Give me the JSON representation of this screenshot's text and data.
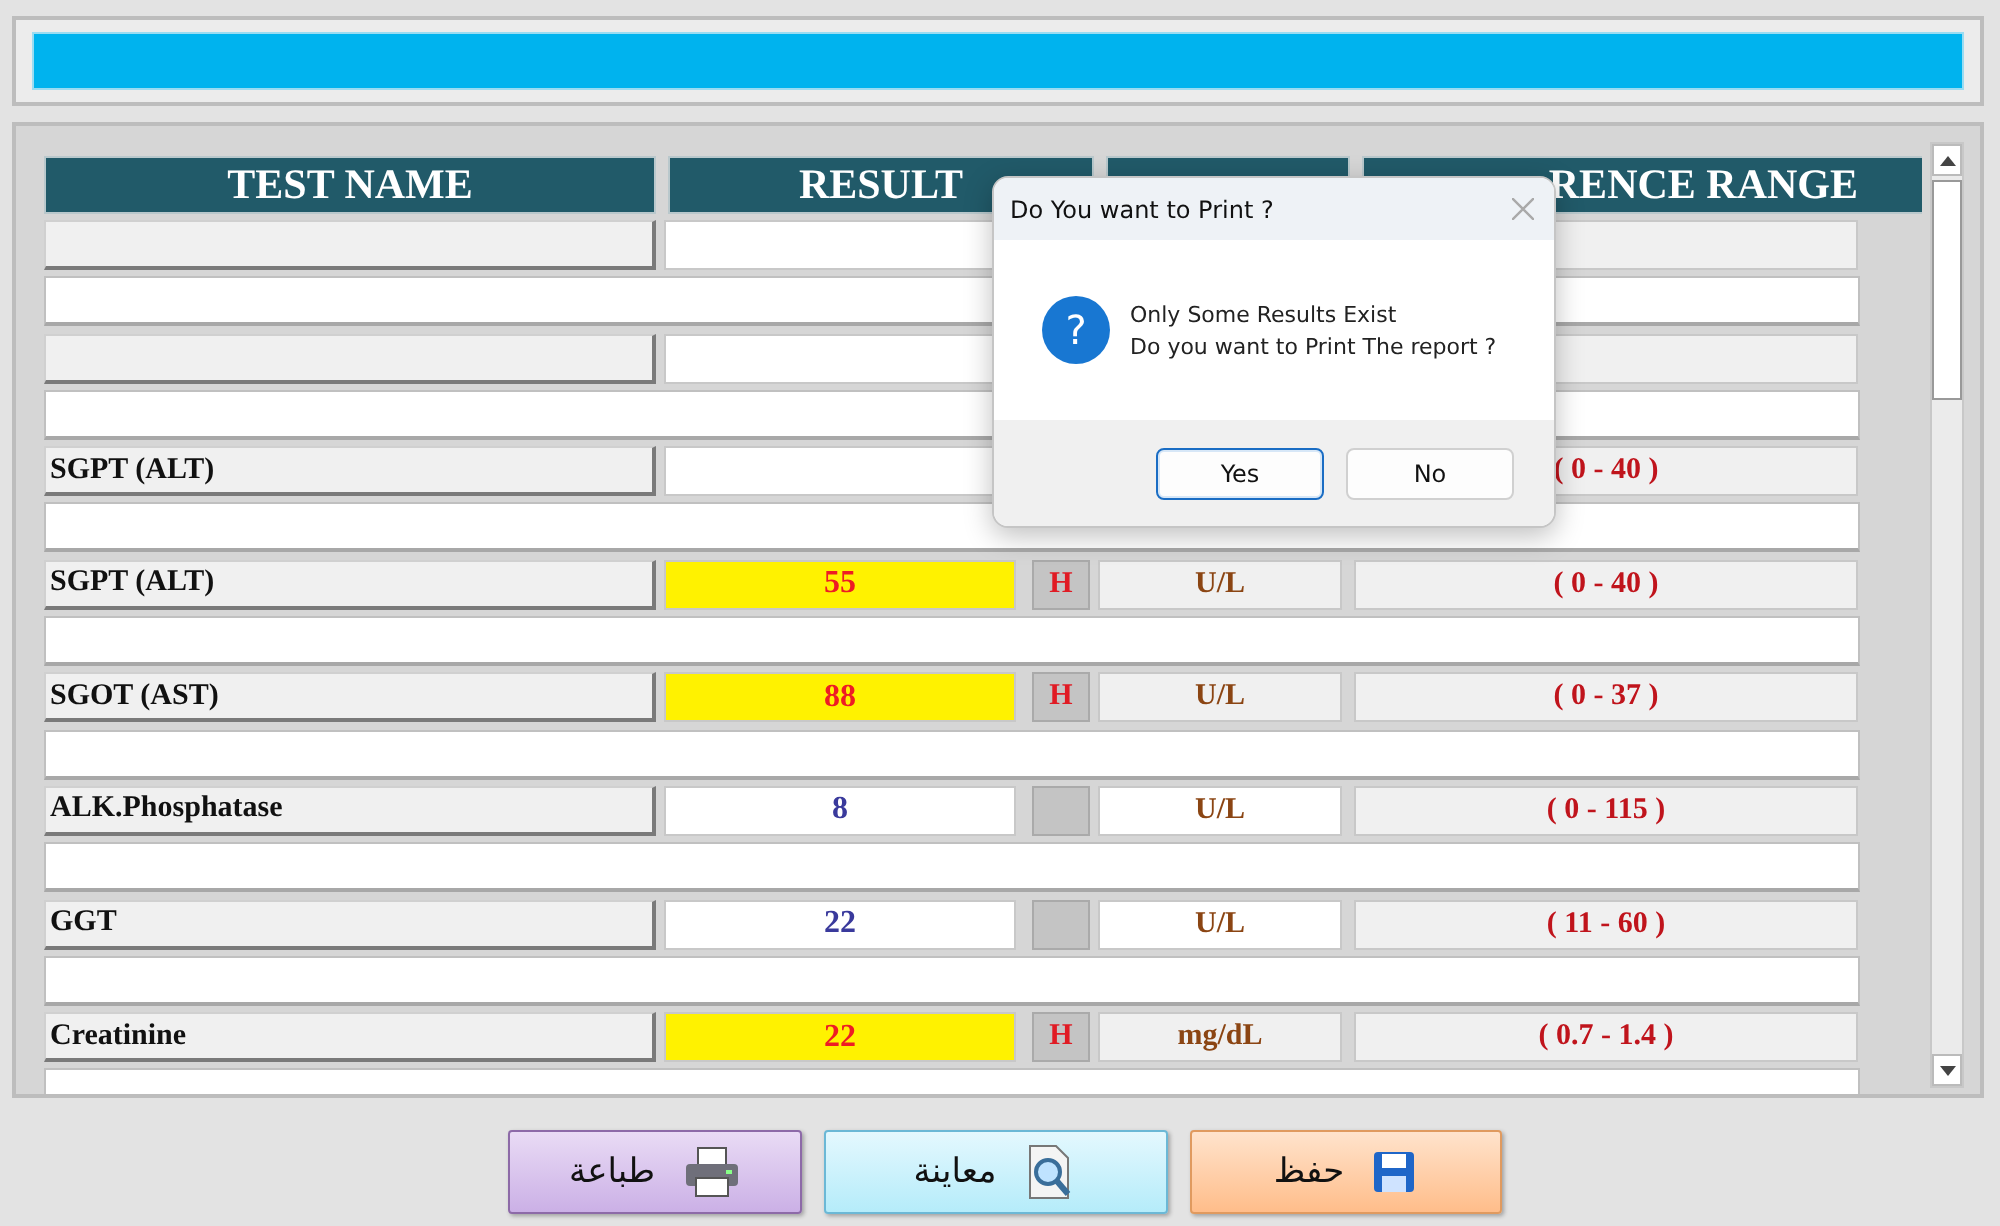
{
  "columns": [
    {
      "label": "TEST NAME"
    },
    {
      "label": "RESULT"
    },
    {},
    {
      "label": "RENCE RANGE"
    }
  ],
  "rows": [
    {
      "kind": "blank",
      "high": false
    },
    {
      "kind": "note"
    },
    {
      "kind": "blank",
      "high": false
    },
    {
      "kind": "note"
    },
    {
      "kind": "test",
      "name": "SGPT (ALT)",
      "high": false,
      "range": "( 0 - 40 )"
    },
    {
      "kind": "note"
    },
    {
      "kind": "test",
      "name": "SGPT (ALT)",
      "result": "55",
      "high": true,
      "flag": "H",
      "unit": "U/L",
      "range": "( 0 - 40 )"
    },
    {
      "kind": "note"
    },
    {
      "kind": "test",
      "name": "SGOT (AST)",
      "result": "88",
      "high": true,
      "flag": "H",
      "unit": "U/L",
      "range": "( 0 - 37 )"
    },
    {
      "kind": "note"
    },
    {
      "kind": "test",
      "name": "ALK.Phosphatase",
      "result": "8",
      "high": false,
      "unit": "U/L",
      "range": "( 0 - 115 )"
    },
    {
      "kind": "note"
    },
    {
      "kind": "test",
      "name": "GGT",
      "result": "22",
      "high": false,
      "unit": "U/L",
      "range": "( 11 - 60 )"
    },
    {
      "kind": "note"
    },
    {
      "kind": "test",
      "name": "Creatinine",
      "result": "22",
      "high": true,
      "flag": "H",
      "unit": "mg/dL",
      "range": "( 0.7 - 1.4 )"
    },
    {
      "kind": "note"
    }
  ],
  "dialog": {
    "title": "Do You want to Print ?",
    "icon": "?",
    "lines": [
      "Only Some Results Exist",
      "Do you want to Print The report ?"
    ],
    "buttons": [
      {
        "label": "Yes",
        "selected": true
      },
      {
        "label": "No",
        "selected": false
      }
    ]
  },
  "actions": [
    {
      "kind": "save",
      "label": "حفظ"
    },
    {
      "kind": "preview",
      "label": "معاينة"
    },
    {
      "kind": "print",
      "label": "طباعة"
    }
  ]
}
